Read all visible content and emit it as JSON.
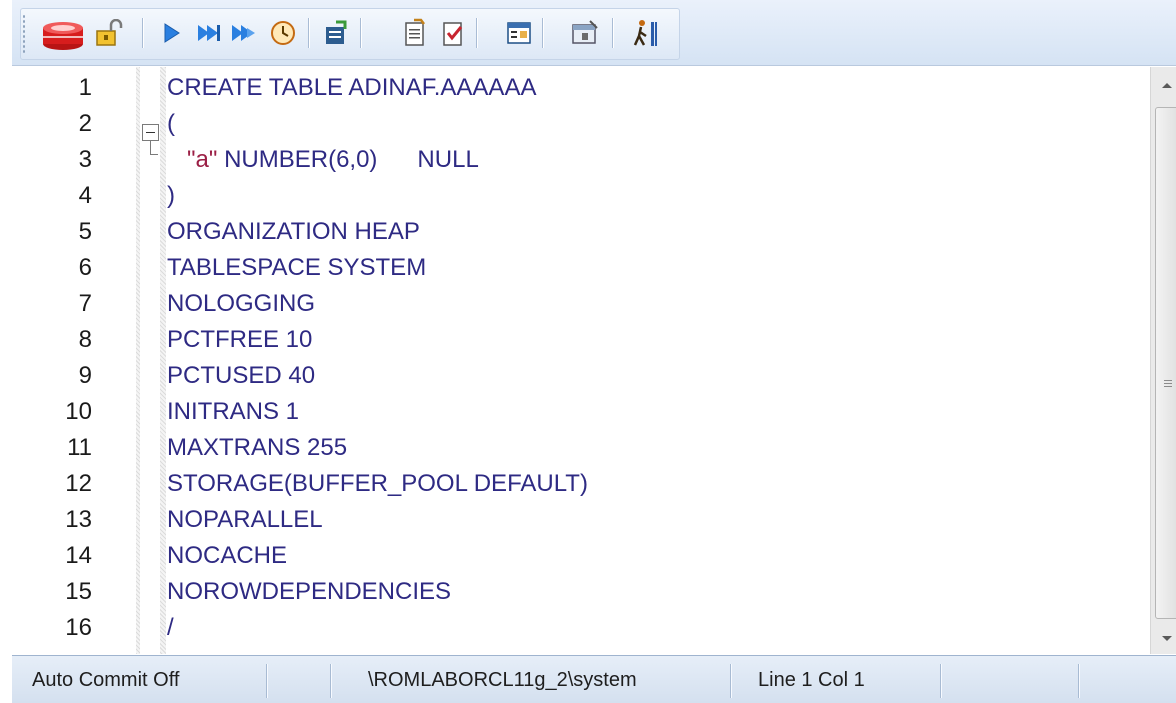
{
  "toolbar": {
    "buttons": [
      {
        "name": "connect-database-icon"
      },
      {
        "name": "lock-icon"
      },
      {
        "name": "execute-icon"
      },
      {
        "name": "execute-step-icon"
      },
      {
        "name": "execute-script-icon"
      },
      {
        "name": "history-clock-icon"
      },
      {
        "name": "explain-plan-icon"
      },
      {
        "name": "commit-icon"
      },
      {
        "name": "rollback-icon"
      },
      {
        "name": "output-window-icon"
      },
      {
        "name": "options-icon"
      },
      {
        "name": "exit-icon"
      }
    ]
  },
  "editor": {
    "line_numbers": [
      "1",
      "2",
      "3",
      "4",
      "5",
      "6",
      "7",
      "8",
      "9",
      "10",
      "11",
      "12",
      "13",
      "14",
      "15",
      "16"
    ],
    "lines": [
      {
        "text": "CREATE TABLE ADINAF.AAAAAA"
      },
      {
        "text": "("
      },
      {
        "indent": "   ",
        "str": "\"a\"",
        "rest": " NUMBER(6,0)      NULL"
      },
      {
        "text": ")"
      },
      {
        "text": "ORGANIZATION HEAP"
      },
      {
        "text": "TABLESPACE SYSTEM"
      },
      {
        "text": "NOLOGGING"
      },
      {
        "text": "PCTFREE 10"
      },
      {
        "text": "PCTUSED 40"
      },
      {
        "text": "INITRANS 1"
      },
      {
        "text": "MAXTRANS 255"
      },
      {
        "text": "STORAGE(BUFFER_POOL DEFAULT)"
      },
      {
        "text": "NOPARALLEL"
      },
      {
        "text": "NOCACHE"
      },
      {
        "text": "NOROWDEPENDENCIES"
      },
      {
        "text": "/"
      }
    ]
  },
  "statusbar": {
    "commit_mode": "Auto Commit Off",
    "connection": "\\ROMLABORCL11g_2\\system",
    "cursor_position": "Line 1 Col 1",
    "extra": ""
  }
}
